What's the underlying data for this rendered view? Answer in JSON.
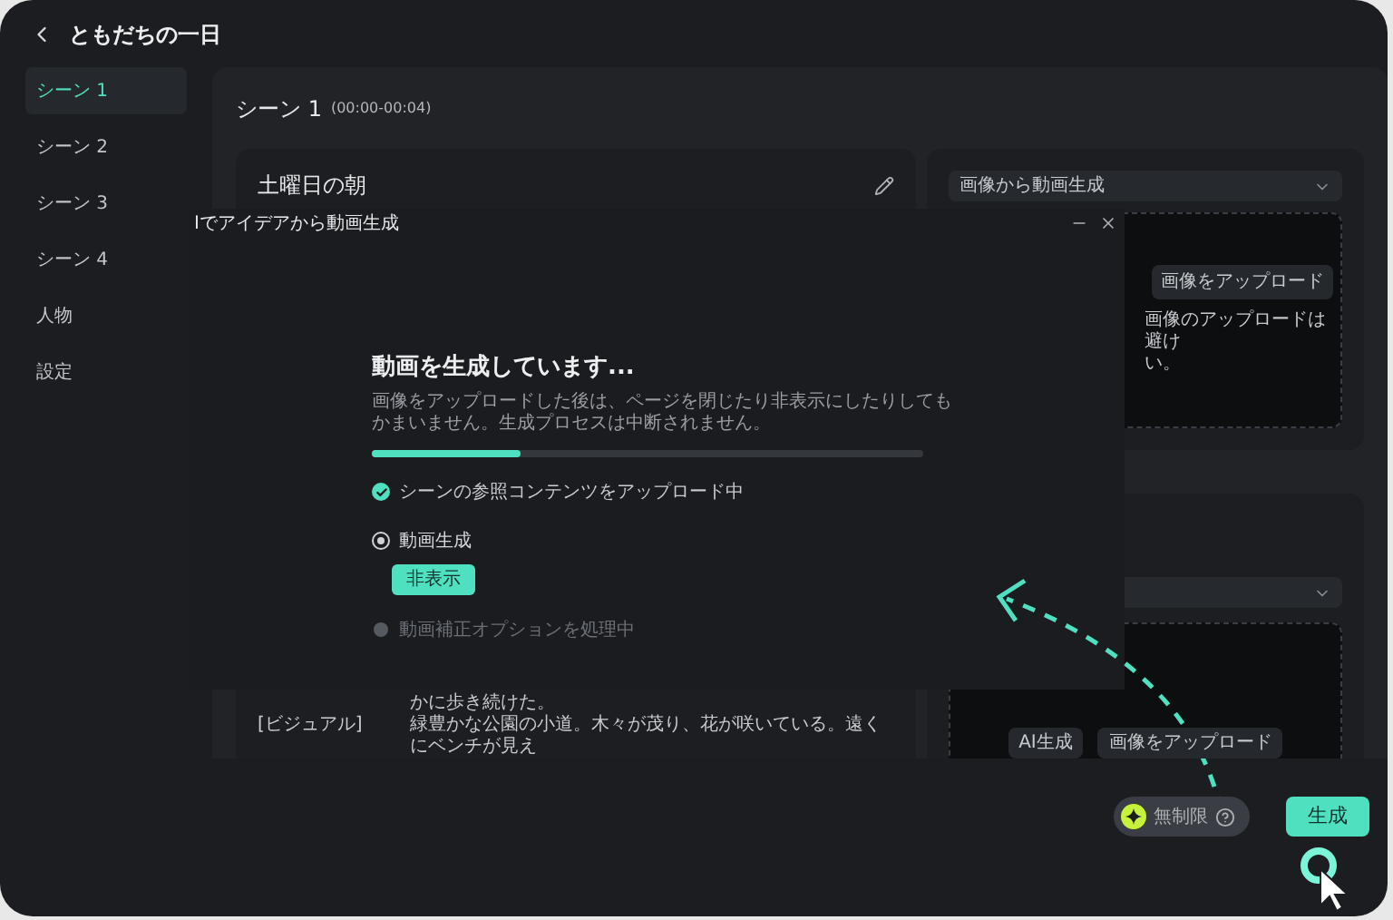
{
  "header": {
    "title": "ともだちの一日"
  },
  "sidebar": {
    "items": [
      {
        "label": "シーン 1",
        "selected": true
      },
      {
        "label": "シーン 2",
        "selected": false
      },
      {
        "label": "シーン 3",
        "selected": false
      },
      {
        "label": "シーン 4",
        "selected": false
      },
      {
        "label": "人物",
        "selected": false
      },
      {
        "label": "設定",
        "selected": false
      }
    ]
  },
  "scene": {
    "title": "シーン 1",
    "time": "(00:00-00:04)",
    "script_card": {
      "title": "土曜日の朝",
      "lines": [
        {
          "text": "かに歩き続けた。"
        },
        {
          "label": "[ビジュアル]",
          "text": "緑豊かな公園の小道。木々が茂り、花が咲いている。遠くにベンチが見え"
        }
      ]
    },
    "image_card": {
      "mode": "画像から動画生成",
      "upload_button": "画像をアップロード",
      "note_lines": [
        "画像のアップロードは避け",
        "い。"
      ]
    },
    "second_card": {
      "buttons": [
        "AI生成",
        "画像をアップロード"
      ]
    }
  },
  "dialog": {
    "title": "Iでアイデアから動画生成",
    "heading": "動画を生成しています...",
    "subtitle": "画像をアップロードした後は、ページを閉じたり非表示にしたりしてもかまいません。生成プロセスは中断されません。",
    "progress": {
      "level": 0.27
    },
    "steps": [
      {
        "label": "シーンの参照コンテンツをアップロード中",
        "kind": "done"
      },
      {
        "label": "動画生成",
        "kind": "active",
        "button": "非表示"
      },
      {
        "label": "動画補正オプションを処理中",
        "kind": "pending"
      }
    ]
  },
  "footer": {
    "credits": "無制限",
    "generate_button": "生成"
  }
}
